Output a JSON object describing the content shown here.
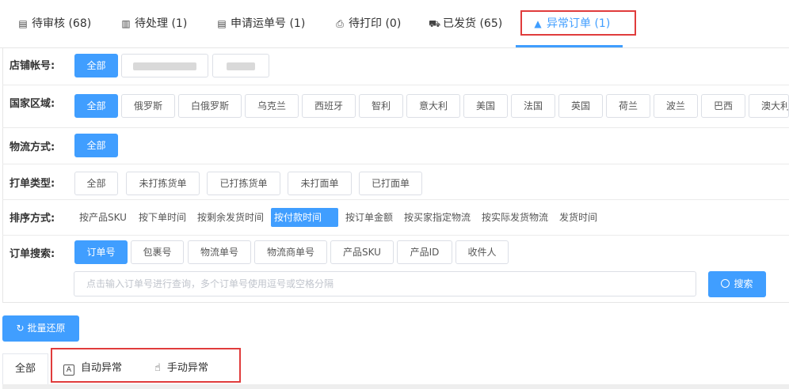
{
  "tabs": [
    {
      "label": "待审核 (68)",
      "icon": "document-review-icon"
    },
    {
      "label": "待处理 (1)",
      "icon": "document-icon"
    },
    {
      "label": "申请运单号 (1)",
      "icon": "document-list-icon"
    },
    {
      "label": "待打印 (0)",
      "icon": "printer-icon"
    },
    {
      "label": "已发货 (65)",
      "icon": "truck-icon"
    },
    {
      "label": "异常订单 (1)",
      "icon": "warning-icon",
      "active": true
    }
  ],
  "filters": {
    "store": {
      "label": "店铺帐号:",
      "options": [
        "全部"
      ]
    },
    "country": {
      "label": "国家区域:",
      "options": [
        "全部",
        "俄罗斯",
        "白俄罗斯",
        "乌克兰",
        "西班牙",
        "智利",
        "意大利",
        "美国",
        "法国",
        "英国",
        "荷兰",
        "波兰",
        "巴西",
        "澳大利"
      ]
    },
    "logistics": {
      "label": "物流方式:",
      "options": [
        "全部"
      ]
    },
    "print_type": {
      "label": "打单类型:",
      "options": [
        "全部",
        "未打拣货单",
        "已打拣货单",
        "未打面单",
        "已打面单"
      ]
    },
    "sort": {
      "label": "排序方式:",
      "options": [
        "按产品SKU",
        "按下单时间",
        "按剩余发货时间",
        "按付款时间",
        "按订单金额",
        "按买家指定物流",
        "按实际发货物流",
        "发货时间"
      ]
    },
    "search": {
      "label": "订单搜索:",
      "options": [
        "订单号",
        "包裹号",
        "物流单号",
        "物流商单号",
        "产品SKU",
        "产品ID",
        "收件人"
      ],
      "placeholder": "点击输入订单号进行查询，多个订单号使用逗号或空格分隔",
      "button": "搜索"
    }
  },
  "batch_restore": "批量还原",
  "subtabs": [
    {
      "label": "全部"
    },
    {
      "label": "自动异常",
      "icon": "auto-icon"
    },
    {
      "label": "手动异常",
      "icon": "hand-pointer-icon"
    }
  ],
  "colors": {
    "accent": "#409eff",
    "highlight": "#e03c3c"
  }
}
